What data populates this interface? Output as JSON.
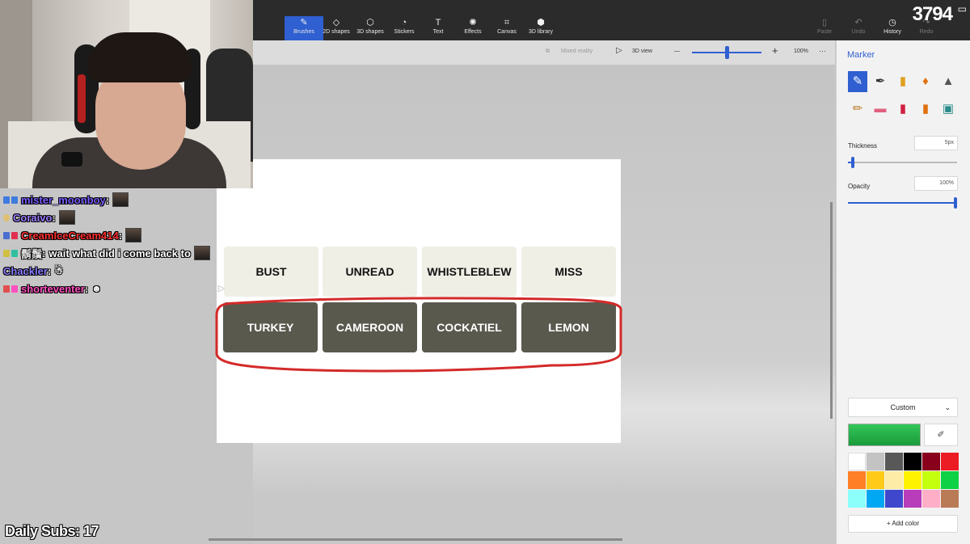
{
  "toolbar": {
    "tools": [
      {
        "label": "Brushes",
        "icon": "brush-icon",
        "glyph": "✎"
      },
      {
        "label": "2D shapes",
        "icon": "2d-shapes-icon",
        "glyph": "◇"
      },
      {
        "label": "3D shapes",
        "icon": "3d-shapes-icon",
        "glyph": "⬡"
      },
      {
        "label": "Stickers",
        "icon": "stickers-icon",
        "glyph": "◔"
      },
      {
        "label": "Text",
        "icon": "text-icon",
        "glyph": "T"
      },
      {
        "label": "Effects",
        "icon": "effects-icon",
        "glyph": "✺"
      },
      {
        "label": "Canvas",
        "icon": "canvas-icon",
        "glyph": "⌗"
      },
      {
        "label": "3D library",
        "icon": "3d-library-icon",
        "glyph": "⬢"
      }
    ],
    "right_tools": [
      {
        "label": "Paste",
        "icon": "paste-icon",
        "glyph": "▯"
      },
      {
        "label": "Undo",
        "icon": "undo-icon",
        "glyph": "↶"
      },
      {
        "label": "History",
        "icon": "history-icon",
        "glyph": "◷"
      },
      {
        "label": "Redo",
        "icon": "redo-icon",
        "glyph": "↷"
      }
    ],
    "accent": "#2f5fd0"
  },
  "overlay": {
    "sub_count": "3794",
    "daily_subs": "Daily Subs: 17"
  },
  "viewbar": {
    "mixed_reality": "Mixed reality",
    "view_3d": "3D view",
    "zoom_minus": "—",
    "zoom_plus": "+",
    "zoom_level": "100%",
    "more": "···"
  },
  "canvas": {
    "top_row": [
      "BUST",
      "UNREAD",
      "WHISTLEBLEW",
      "MISS"
    ],
    "bottom_row": [
      "TURKEY",
      "CAMEROON",
      "COCKATIEL",
      "LEMON"
    ],
    "annotation_color": "#d42a2a"
  },
  "panel": {
    "title": "Marker",
    "thickness_label": "Thickness",
    "thickness_value": "5px",
    "opacity_label": "Opacity",
    "opacity_value": "100%",
    "color_mode": "Custom",
    "add_color": "Add color",
    "selected_color": "#2fbf4f",
    "palette": [
      "#ffffff",
      "#c3c3c3",
      "#585858",
      "#000000",
      "#88001b",
      "#ec1c24",
      "#ff7f27",
      "#ffca18",
      "#fdeca6",
      "#fff200",
      "#c4ff0e",
      "#0ed145",
      "#8cfffb",
      "#00a8f3",
      "#3f48cc",
      "#b83dba",
      "#ffaec8",
      "#b97a56"
    ]
  },
  "chat": [
    {
      "user": "mister_moonboy",
      "color": "#7b5cff",
      "message": "",
      "badges": [
        "#3d7be0",
        "#3d7be0"
      ]
    },
    {
      "user": "Coraivo",
      "color": "#9a7bff",
      "message": "",
      "badges": [
        "#e0c070"
      ]
    },
    {
      "user": "CreamIceCream414",
      "color": "#ff3030",
      "message": "",
      "badges": [
        "#4a6fd0",
        "#e03050"
      ]
    },
    {
      "user": "鬍鬚",
      "color": "#dddddd",
      "message": "wait what did i come back to",
      "badges": [
        "#d0c040",
        "#30c0a0"
      ]
    },
    {
      "user": "Chackler",
      "color": "#8a7bff",
      "message": "",
      "badges": []
    },
    {
      "user": "shorteventer",
      "color": "#ff50c0",
      "message": "",
      "badges": [
        "#e05050",
        "#ff50c0"
      ]
    }
  ]
}
